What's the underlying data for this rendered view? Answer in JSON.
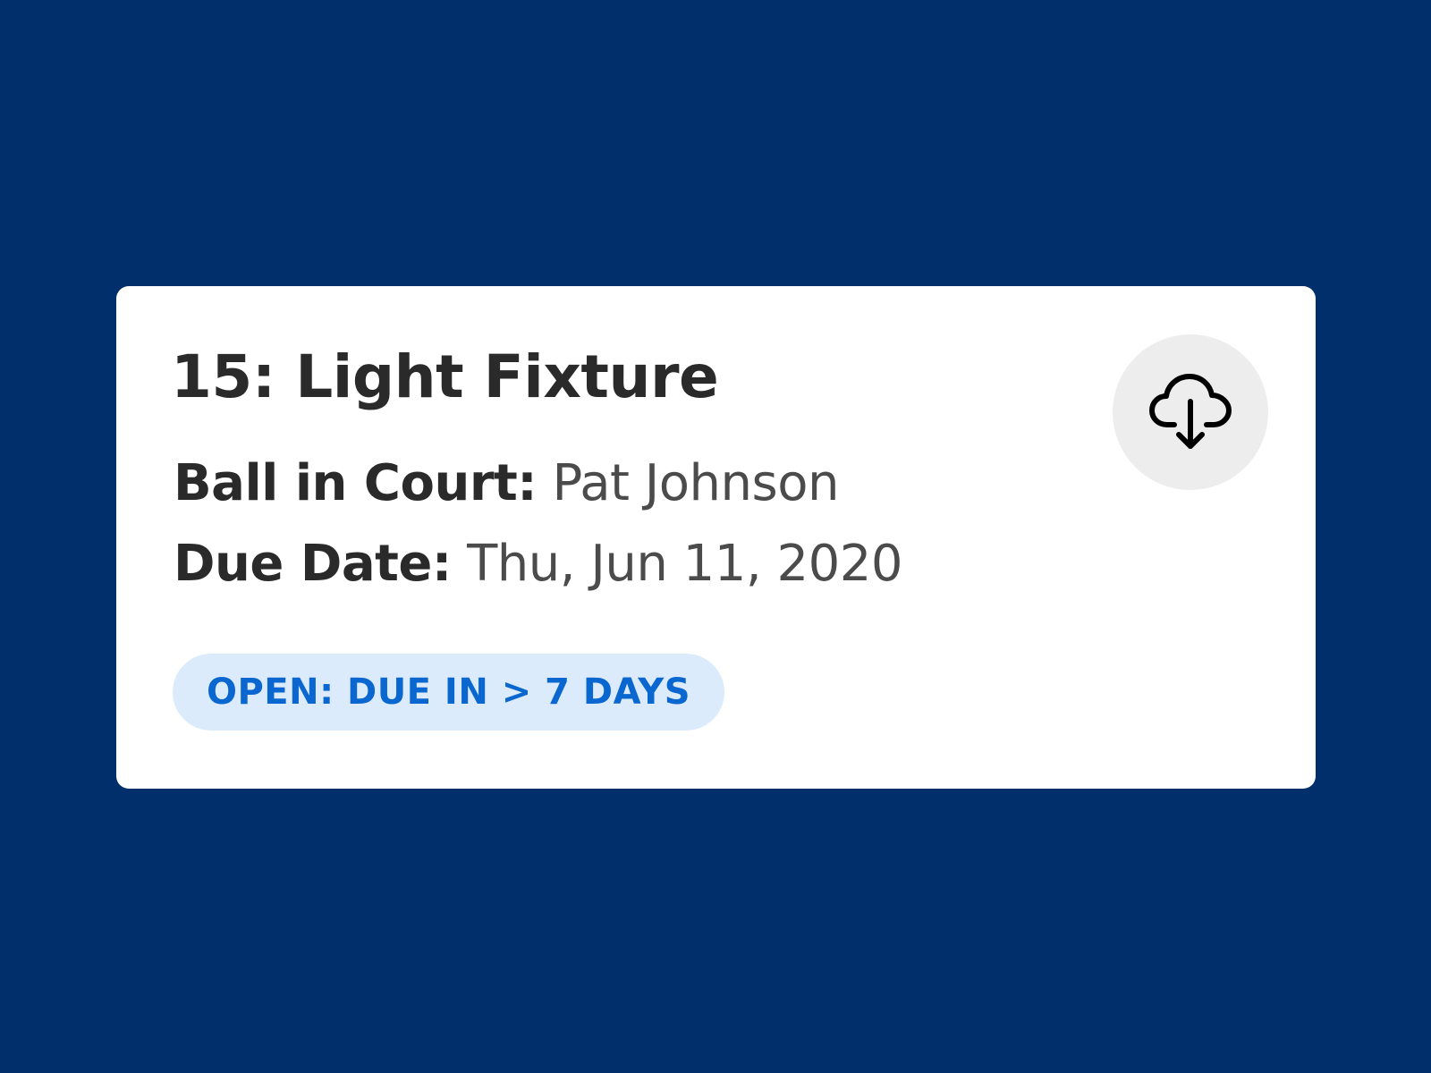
{
  "card": {
    "title": "15: Light Fixture",
    "ball_in_court_label": "Ball in Court:",
    "ball_in_court_value": "Pat Johnson",
    "due_date_label": "Due Date:",
    "due_date_value": "Thu, Jun 11, 2020",
    "status": "OPEN: DUE IN > 7 DAYS",
    "download_icon": "cloud-download-icon"
  },
  "colors": {
    "background": "#002f6c",
    "card": "#ffffff",
    "status_bg": "#dcebfc",
    "status_text": "#0a67d0",
    "icon_button_bg": "#ededee"
  }
}
